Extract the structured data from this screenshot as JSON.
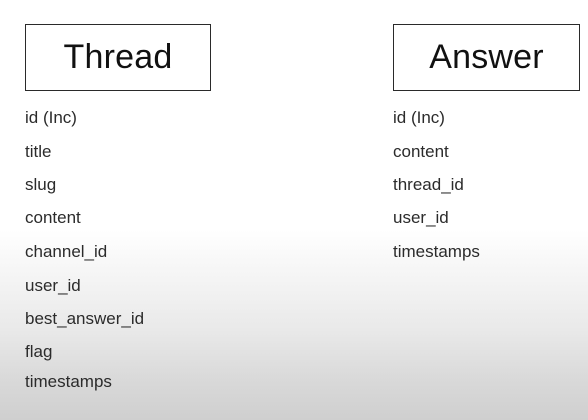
{
  "entities": [
    {
      "title": "Thread",
      "fields": [
        "id (Inc)",
        "title",
        "slug",
        "content",
        "channel_id",
        "user_id",
        "best_answer_id",
        "flag",
        "timestamps"
      ]
    },
    {
      "title": "Answer",
      "fields": [
        "id (Inc)",
        "content",
        "thread_id",
        "user_id",
        "timestamps"
      ]
    }
  ]
}
